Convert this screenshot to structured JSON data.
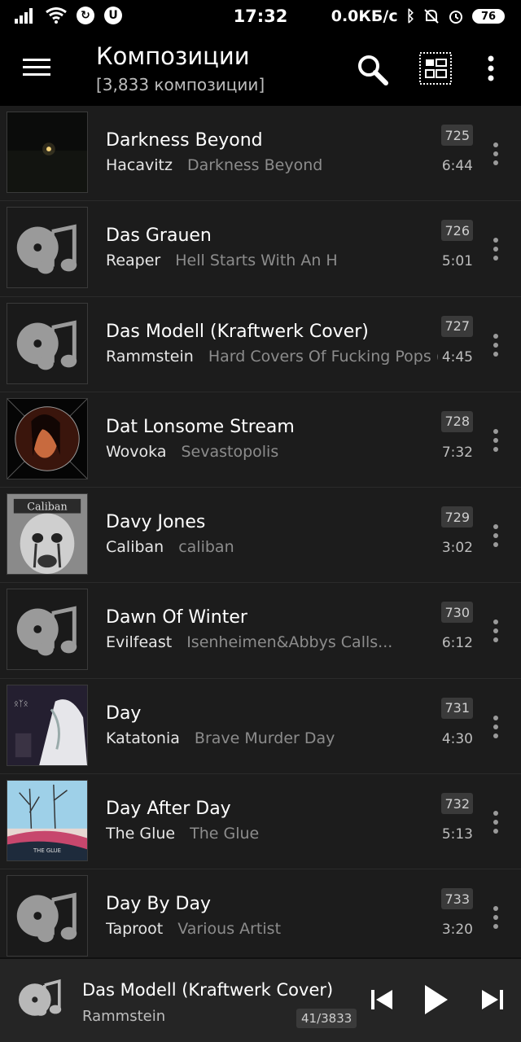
{
  "status": {
    "time": "17:32",
    "net_speed": "0.0КБ/с",
    "battery": "76",
    "badge_a": "U"
  },
  "header": {
    "title": "Композиции",
    "subtitle": "[3,833 композиции]"
  },
  "tracks": [
    {
      "title": "Darkness Beyond",
      "artist": "Hacavitz",
      "album": "Darkness Beyond",
      "number": "725",
      "duration": "6:44",
      "art": "night"
    },
    {
      "title": "Das Grauen",
      "artist": "Reaper",
      "album": "Hell Starts With An H",
      "number": "726",
      "duration": "5:01",
      "art": "placeholder"
    },
    {
      "title": "Das Modell (Kraftwerk Cover)",
      "artist": "Rammstein",
      "album": "Hard Covers Of Fucking Pops (f",
      "number": "727",
      "duration": "4:45",
      "art": "placeholder"
    },
    {
      "title": "Dat Lonsome Stream",
      "artist": "Wovoka",
      "album": "Sevastopolis",
      "number": "728",
      "duration": "7:32",
      "art": "portrait"
    },
    {
      "title": "Davy Jones",
      "artist": "Caliban",
      "album": "caliban",
      "number": "729",
      "duration": "3:02",
      "art": "face"
    },
    {
      "title": "Dawn Of Winter",
      "artist": "Evilfeast",
      "album": "Isenheimen&Abbys Calls...",
      "number": "730",
      "duration": "6:12",
      "art": "placeholder"
    },
    {
      "title": "Day",
      "artist": "Katatonia",
      "album": "Brave Murder Day",
      "number": "731",
      "duration": "4:30",
      "art": "katatonia"
    },
    {
      "title": "Day After Day",
      "artist": "The Glue",
      "album": "The Glue",
      "number": "732",
      "duration": "5:13",
      "art": "glue"
    },
    {
      "title": "Day By Day",
      "artist": "Taproot",
      "album": "Various Artist",
      "number": "733",
      "duration": "3:20",
      "art": "placeholder"
    }
  ],
  "player": {
    "title": "Das Modell (Kraftwerk Cover)",
    "artist": "Rammstein",
    "counter": "41/3833"
  },
  "icons": {
    "menu": "hamburger-icon",
    "search": "search-icon",
    "view": "view-mode-icon",
    "more": "more-vert-icon",
    "placeholder_art": "music-disc-icon",
    "prev": "skip-previous-icon",
    "play": "play-icon",
    "next": "skip-next-icon"
  }
}
